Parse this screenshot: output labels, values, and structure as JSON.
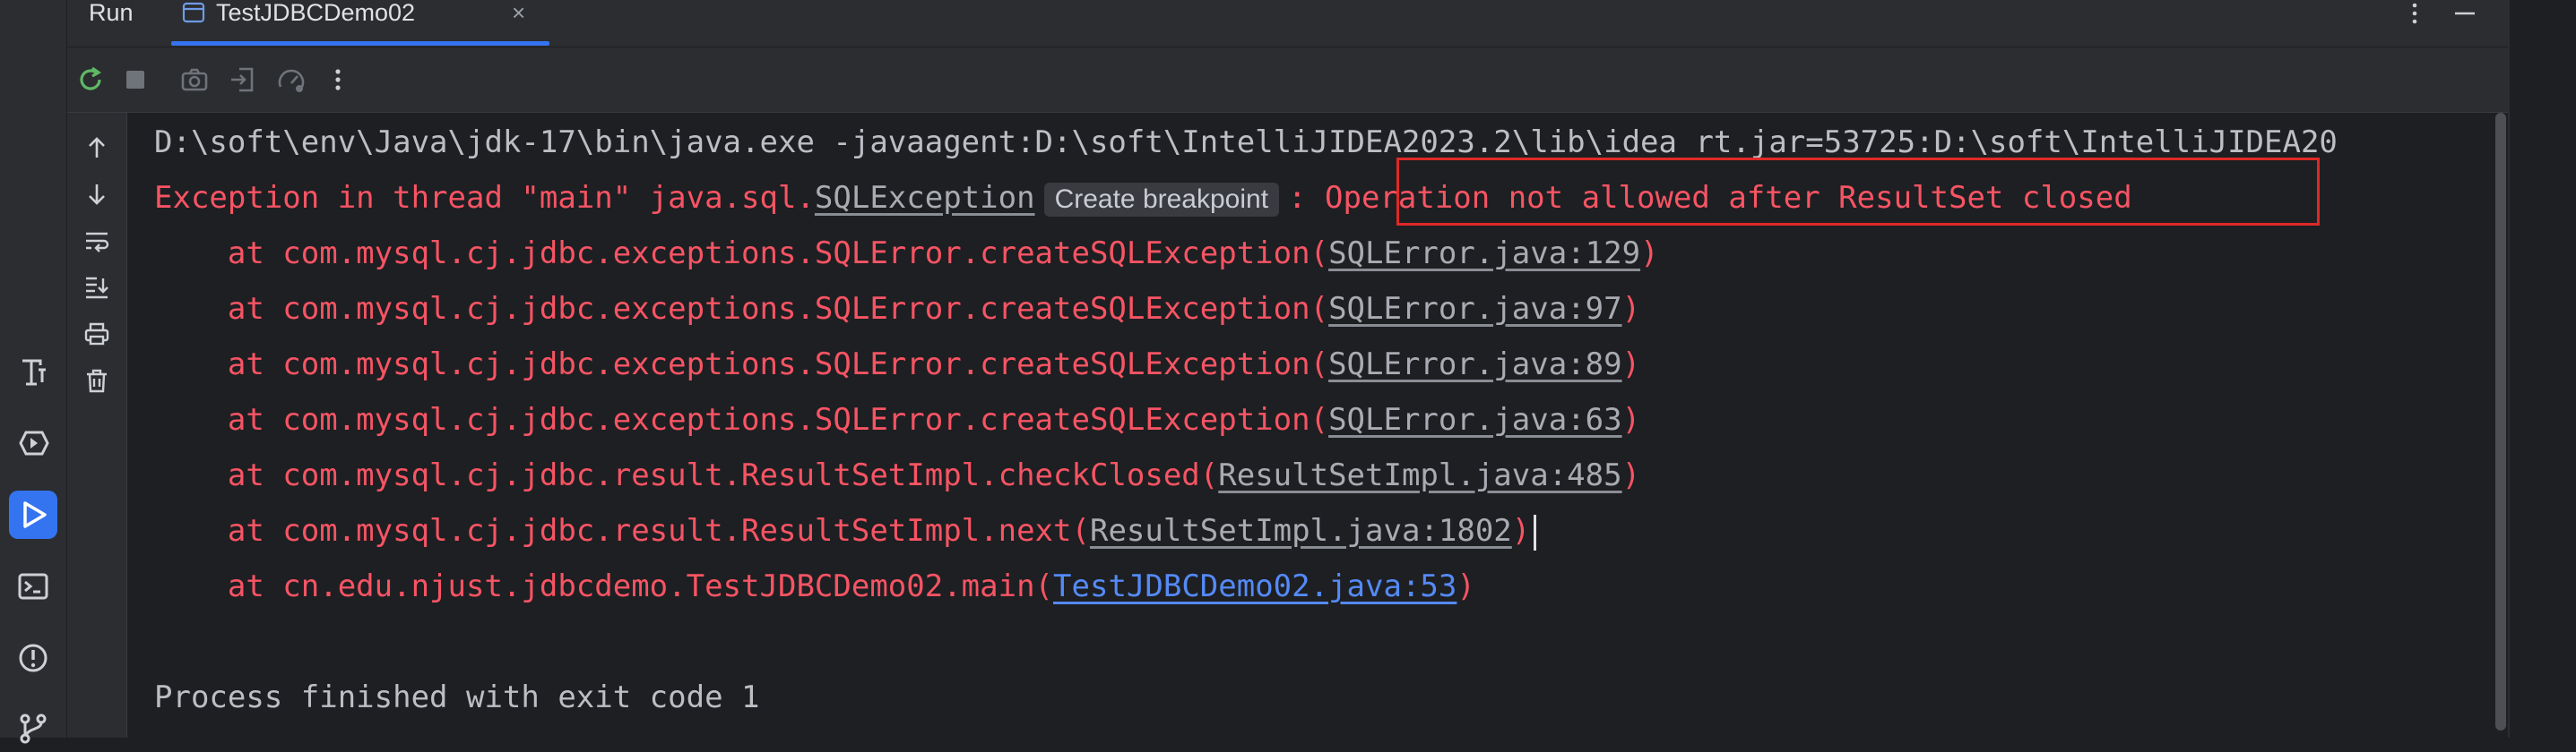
{
  "run_panel": {
    "title": "Run",
    "tab": {
      "label": "TestJDBCDemo02",
      "close": "×"
    },
    "more_menu": "⋮",
    "minimize": "—"
  },
  "console": {
    "command": "D:\\soft\\env\\Java\\jdk-17\\bin\\java.exe -javaagent:D:\\soft\\IntelliJIDEA2023.2\\lib\\idea_rt.jar=53725:D:\\soft\\IntelliJIDEA20",
    "exception_prefix": "Exception in thread \"main\" java.sql.",
    "exception_class": "SQLException",
    "breakpoint_hint": "Create breakpoint",
    "exception_colon": ":",
    "exception_message": " Operation not allowed after ResultSet closed",
    "stack": [
      {
        "at": "    at com.mysql.cj.jdbc.exceptions.SQLError.createSQLException(",
        "link": "SQLError.java:129",
        "close": ")"
      },
      {
        "at": "    at com.mysql.cj.jdbc.exceptions.SQLError.createSQLException(",
        "link": "SQLError.java:97",
        "close": ")"
      },
      {
        "at": "    at com.mysql.cj.jdbc.exceptions.SQLError.createSQLException(",
        "link": "SQLError.java:89",
        "close": ")"
      },
      {
        "at": "    at com.mysql.cj.jdbc.exceptions.SQLError.createSQLException(",
        "link": "SQLError.java:63",
        "close": ")"
      },
      {
        "at": "    at com.mysql.cj.jdbc.result.ResultSetImpl.checkClosed(",
        "link": "ResultSetImpl.java:485",
        "close": ")"
      },
      {
        "at": "    at com.mysql.cj.jdbc.result.ResultSetImpl.next(",
        "link": "ResultSetImpl.java:1802",
        "close": ")"
      },
      {
        "at": "    at cn.edu.njust.jdbcdemo.TestJDBCDemo02.main(",
        "link": "TestJDBCDemo02.java:53",
        "close": ")"
      }
    ],
    "exit_message": "Process finished with exit code 1"
  },
  "colors": {
    "error_text": "#f75464",
    "link_project": "#548af7",
    "highlight_box": "#e02828",
    "accent": "#3574f0"
  },
  "icons": {
    "activity_bar": [
      "font-icon",
      "services-icon",
      "run-icon",
      "terminal-icon",
      "problems-icon",
      "git-icon"
    ],
    "toolbar": [
      "rerun-icon",
      "stop-icon",
      "camera-icon",
      "exit-icon",
      "speedometer-icon",
      "more-vertical-icon"
    ],
    "side_tools": [
      "arrow-up-icon",
      "arrow-down-icon",
      "soft-wrap-icon",
      "scroll-to-end-icon",
      "print-icon",
      "trash-icon"
    ]
  }
}
